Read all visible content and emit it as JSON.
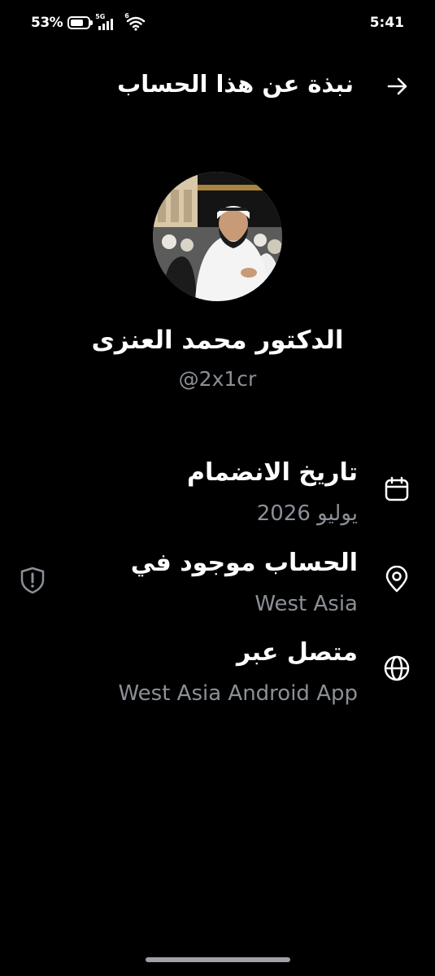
{
  "status_bar": {
    "battery_percent": "53%",
    "network_label": "5G",
    "wifi_label": "6",
    "time": "5:41"
  },
  "header": {
    "title": "نبذة عن هذا الحساب",
    "back_icon": "arrow-right-icon"
  },
  "profile": {
    "display_name": "الدكتور محمد العنزى",
    "handle": "@2x1cr"
  },
  "info": [
    {
      "title": "تاريخ الانضمام",
      "value": "يوليو 2026",
      "icon": "calendar-icon"
    },
    {
      "title": "الحساب موجود في",
      "value": "West Asia",
      "icon": "location-pin-icon"
    },
    {
      "title": "متصل عبر",
      "value": "West Asia Android App",
      "icon": "globe-icon"
    }
  ],
  "colors": {
    "background": "#000000",
    "text": "#ffffff",
    "secondary_text": "#8b9097"
  }
}
